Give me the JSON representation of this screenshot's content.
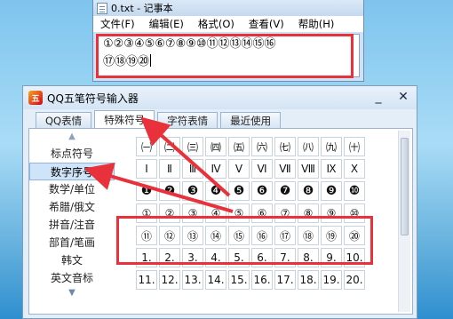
{
  "notepad": {
    "title": "0.txt - 记事本",
    "menu": [
      "文件(F)",
      "编辑(E)",
      "格式(O)",
      "查看(V)",
      "帮助(H)"
    ],
    "line1": "①②③④⑤⑥⑦⑧⑨⑩⑪⑫⑬⑭⑮⑯",
    "line2": "⑰⑱⑲⑳"
  },
  "ime": {
    "title": "QQ五笔符号输入器",
    "controls": [
      "_",
      "✕"
    ],
    "tabs": [
      "QQ表情",
      "特殊符号",
      "字符表情",
      "最近使用"
    ],
    "categories": [
      "标点符号",
      "数字序号",
      "数学/单位",
      "希腊/俄文",
      "拼音/注音",
      "部首/笔画",
      "韩文",
      "英文音标"
    ],
    "selected_category": "数字序号",
    "grid": [
      [
        "㈠",
        "㈡",
        "㈢",
        "㈣",
        "㈤",
        "㈥",
        "㈦",
        "㈧",
        "㈨",
        "㈩"
      ],
      [
        "Ⅰ",
        "Ⅱ",
        "Ⅲ",
        "Ⅳ",
        "Ⅴ",
        "Ⅵ",
        "Ⅶ",
        "Ⅷ",
        "Ⅸ",
        "Ⅹ"
      ],
      [
        "❶",
        "❷",
        "❸",
        "❹",
        "❺",
        "❻",
        "❼",
        "❽",
        "❾",
        "❿"
      ],
      [
        "①",
        "②",
        "③",
        "④",
        "⑤",
        "⑥",
        "⑦",
        "⑧",
        "⑨",
        "⑩"
      ],
      [
        "⑪",
        "⑫",
        "⑬",
        "⑭",
        "⑮",
        "⑯",
        "⑰",
        "⑱",
        "⑲",
        "⑳"
      ],
      [
        "1.",
        "2.",
        "3.",
        "4.",
        "5.",
        "6.",
        "7.",
        "8.",
        "9.",
        "10."
      ],
      [
        "11.",
        "12.",
        "13.",
        "14.",
        "15.",
        "16.",
        "17.",
        "18.",
        "19.",
        "20."
      ]
    ]
  },
  "colors": {
    "highlight": "#e8313a",
    "accent": "#cfe4f8"
  }
}
